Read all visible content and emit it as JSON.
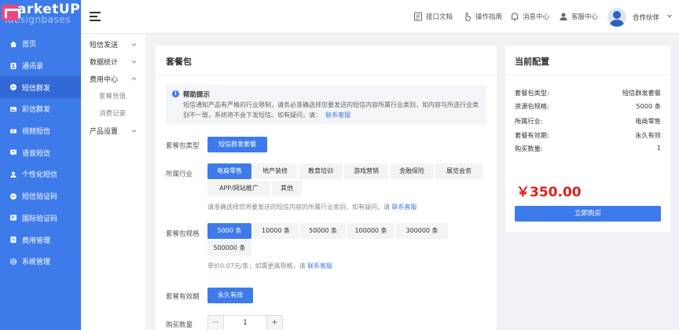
{
  "logo": {
    "brand": "arketUP",
    "sub": "idesignbases"
  },
  "sidebar": {
    "items": [
      {
        "label": "首页",
        "icon": "home-icon"
      },
      {
        "label": "通讯录",
        "icon": "contacts-icon"
      },
      {
        "label": "短信群发",
        "icon": "sms-icon",
        "active": true
      },
      {
        "label": "彩信群发",
        "icon": "mms-icon"
      },
      {
        "label": "视频短信",
        "icon": "video-icon"
      },
      {
        "label": "语音短信",
        "icon": "voice-icon"
      },
      {
        "label": "个性化短信",
        "icon": "custom-sms-icon"
      },
      {
        "label": "短信验证码",
        "icon": "verify-code-icon"
      },
      {
        "label": "国际验证码",
        "icon": "intl-code-icon"
      },
      {
        "label": "费用管理",
        "icon": "fee-icon"
      },
      {
        "label": "系统管理",
        "icon": "settings-icon"
      }
    ]
  },
  "topbar": {
    "links": [
      {
        "label": "接口文档",
        "icon": "doc-icon"
      },
      {
        "label": "操作指南",
        "icon": "hand-icon"
      },
      {
        "label": "消息中心",
        "icon": "bell-icon"
      },
      {
        "label": "客服中心",
        "icon": "service-icon"
      }
    ],
    "user": "合作伙伴"
  },
  "submenu": {
    "groups": [
      {
        "label": "短信发送",
        "expanded": false,
        "children": []
      },
      {
        "label": "数据统计",
        "expanded": false,
        "children": []
      },
      {
        "label": "费用中心",
        "expanded": true,
        "children": [
          "套餐充值",
          "消费记录"
        ]
      },
      {
        "label": "产品设置",
        "expanded": false,
        "children": []
      }
    ]
  },
  "main": {
    "title": "套餐包",
    "help": {
      "title": "帮助提示",
      "text": "短信通知产品有严格的行业限制，请务必准确选择您要发送的短信内容所属行业类别，如内容与所选行业类别不一致，系统将不会下发短信。如有疑问，请：",
      "link": "联系客服"
    },
    "package_type": {
      "label": "套餐包类型",
      "options": [
        "短信群发套餐"
      ],
      "selected": 0
    },
    "industry": {
      "label": "所属行业",
      "options": [
        "电商零售",
        "地产装修",
        "教育培训",
        "游戏营销",
        "金融保险",
        "展览会务",
        "APP/网站推广",
        "其他"
      ],
      "selected": 0,
      "hint": "请准确选择您将要发送的短信内容的所属行业类别，如有疑问，请",
      "hint_link": "联系客服"
    },
    "spec": {
      "label": "套餐包规格",
      "options": [
        "5000 条",
        "10000 条",
        "50000 条",
        "100000 条",
        "300000 条",
        "500000 条"
      ],
      "selected": 0,
      "hint": "单价0.07元/条；如需更高规格，请",
      "hint_link": "联系客服"
    },
    "validity": {
      "label": "套餐有效期",
      "options": [
        "永久有效"
      ],
      "selected": 0
    },
    "quantity": {
      "label": "购买数量",
      "value": "1",
      "minus": "−",
      "plus": "+"
    }
  },
  "config": {
    "title": "当前配置",
    "rows": [
      {
        "key": "套餐包类型:",
        "value": "短信群发套餐"
      },
      {
        "key": "资源包规格:",
        "value": "5000 条"
      },
      {
        "key": "所属行业:",
        "value": "电商零售"
      },
      {
        "key": "套餐有效期:",
        "value": "永久有效"
      },
      {
        "key": "购买数量:",
        "value": "1"
      }
    ],
    "price": "￥350.00",
    "buy_label": "立即购买"
  },
  "colors": {
    "primary": "#3e7bea",
    "price": "#e02020",
    "logo": "#e9487d"
  }
}
